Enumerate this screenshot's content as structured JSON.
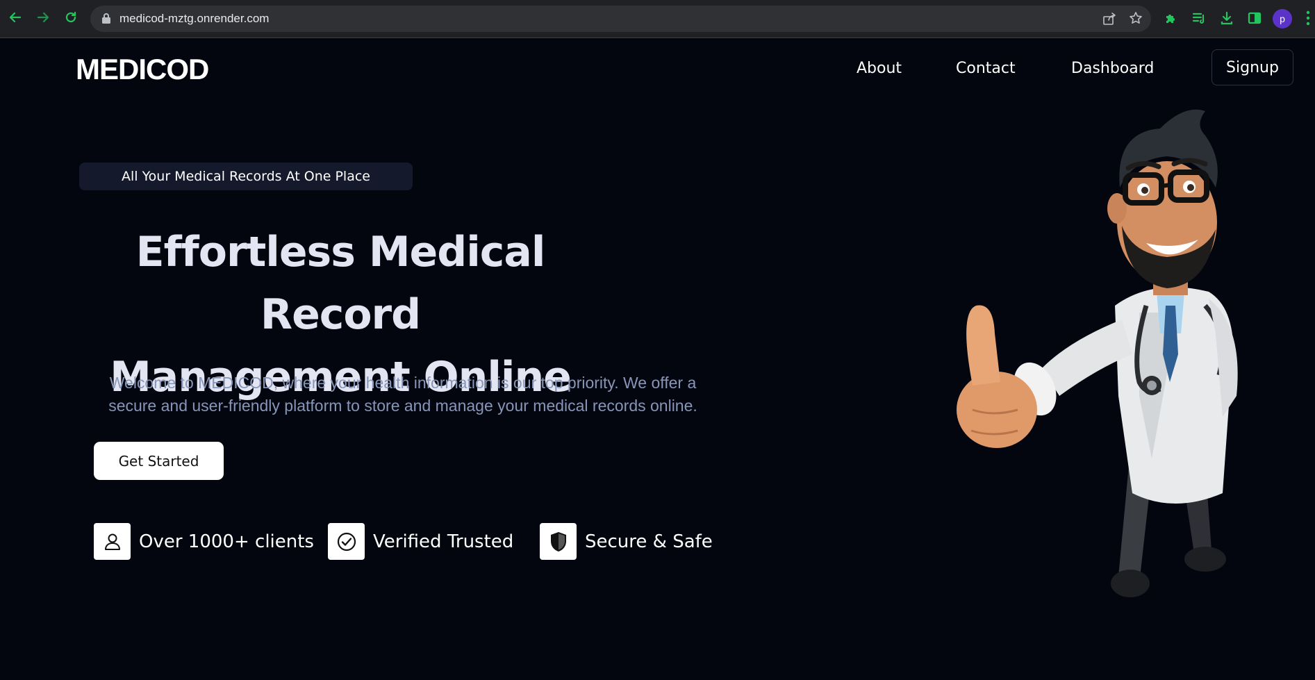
{
  "browser": {
    "url": "medicod-mztg.onrender.com",
    "profile_initial": "p",
    "icons": [
      "back-arrow-icon",
      "forward-arrow-icon",
      "reload-icon",
      "lock-icon",
      "share-icon",
      "star-icon",
      "puzzle-extension-icon",
      "media-queue-icon",
      "download-icon",
      "side-panel-icon",
      "more-menu-icon"
    ]
  },
  "site": {
    "logo": "MEDICOD",
    "nav": {
      "about": "About",
      "contact": "Contact",
      "dashboard": "Dashboard",
      "signup": "Signup"
    }
  },
  "hero": {
    "tagline": "All Your Medical Records At One Place",
    "headline_line1": "Effortless Medical Record",
    "headline_line2": "Management Online",
    "intro_line1": "Welcome to MEDICOD, where your health information is our top priority. We offer a",
    "intro_line2": "secure and user-friendly platform to store and manage your medical records online.",
    "cta": "Get Started",
    "features": [
      {
        "icon": "user-icon",
        "label": "Over 1000+ clients"
      },
      {
        "icon": "check-circle-icon",
        "label": "Verified Trusted"
      },
      {
        "icon": "shield-icon",
        "label": "Secure & Safe"
      }
    ]
  },
  "colors": {
    "page_bg": "#03060f",
    "chrome_bg": "#202124",
    "tagline_bg": "#141a2c",
    "headline": "#e3e5f3",
    "intro_text": "#8796b8",
    "extension_green": "#22c55e",
    "avatar": "#5b33c9"
  }
}
